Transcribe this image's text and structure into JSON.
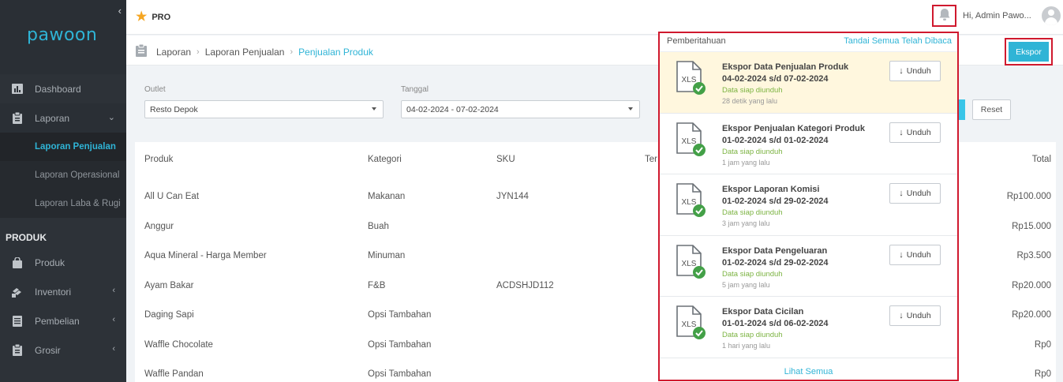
{
  "brand": {
    "logo_text": "pawoon",
    "accent": "#2fb4d6"
  },
  "sidebar": {
    "items": [
      {
        "label": "Dashboard",
        "icon": "bar-chart-icon"
      },
      {
        "label": "Laporan",
        "icon": "clipboard-icon"
      }
    ],
    "laporan_sub": [
      {
        "label": "Laporan Penjualan",
        "active": true
      },
      {
        "label": "Laporan Operasional"
      },
      {
        "label": "Laporan Laba & Rugi"
      }
    ],
    "section": "PRODUK",
    "produk_items": [
      {
        "label": "Produk",
        "icon": "bag-icon"
      },
      {
        "label": "Inventori",
        "icon": "boxes-icon"
      },
      {
        "label": "Pembelian",
        "icon": "list-icon"
      },
      {
        "label": "Grosir",
        "icon": "clipboard-icon"
      }
    ]
  },
  "topbar": {
    "plan": "PRO",
    "greeting": "Hi, Admin Pawo..."
  },
  "breadcrumb": {
    "items": [
      "Laporan",
      "Laporan Penjualan",
      "Penjualan Produk"
    ],
    "export_label": "Ekspor"
  },
  "filters": {
    "outlet_label": "Outlet",
    "outlet_value": "Resto Depok",
    "date_label": "Tanggal",
    "date_value": "04-02-2024 - 07-02-2024",
    "reset_label": "Reset"
  },
  "table": {
    "headers": {
      "product": "Produk",
      "category": "Kategori",
      "sku": "SKU",
      "partial": "Ter",
      "total": "Total"
    },
    "rows": [
      {
        "product": "All U Can Eat",
        "category": "Makanan",
        "sku": "JYN144",
        "total": "Rp100.000"
      },
      {
        "product": "Anggur",
        "category": "Buah",
        "sku": "",
        "total": "Rp15.000"
      },
      {
        "product": "Aqua Mineral - Harga Member",
        "category": "Minuman",
        "sku": "",
        "total": "Rp3.500"
      },
      {
        "product": "Ayam Bakar",
        "category": "F&B",
        "sku": "ACDSHJD112",
        "total": "Rp20.000"
      },
      {
        "product": "Daging Sapi",
        "category": "Opsi Tambahan",
        "sku": "",
        "total": "Rp20.000"
      },
      {
        "product": "Waffle Chocolate",
        "category": "Opsi Tambahan",
        "sku": "",
        "total": "Rp0"
      },
      {
        "product": "Waffle Pandan",
        "category": "Opsi Tambahan",
        "sku": "",
        "total": "Rp0"
      }
    ]
  },
  "notifications": {
    "title": "Pemberitahuan",
    "mark_all": "Tandai Semua Telah Dibaca",
    "download_label": "Unduh",
    "file_label": "XLS",
    "see_all": "Lihat Semua",
    "items": [
      {
        "title": "Ekspor Data Penjualan Produk",
        "range": "04-02-2024 s/d 07-02-2024",
        "status": "Data siap diunduh",
        "time": "28 detik yang lalu",
        "unread": true
      },
      {
        "title": "Ekspor Penjualan Kategori Produk",
        "range": "01-02-2024 s/d 01-02-2024",
        "status": "Data siap diunduh",
        "time": "1 jam yang lalu",
        "unread": false
      },
      {
        "title": "Ekspor Laporan Komisi",
        "range": "01-02-2024 s/d 29-02-2024",
        "status": "Data siap diunduh",
        "time": "3 jam yang lalu",
        "unread": false
      },
      {
        "title": "Ekspor Data Pengeluaran",
        "range": "01-02-2024 s/d 29-02-2024",
        "status": "Data siap diunduh",
        "time": "5 jam yang lalu",
        "unread": false
      },
      {
        "title": "Ekspor Data Cicilan",
        "range": "01-01-2024 s/d 06-02-2024",
        "status": "Data siap diunduh",
        "time": "1 hari yang lalu",
        "unread": false
      }
    ]
  }
}
